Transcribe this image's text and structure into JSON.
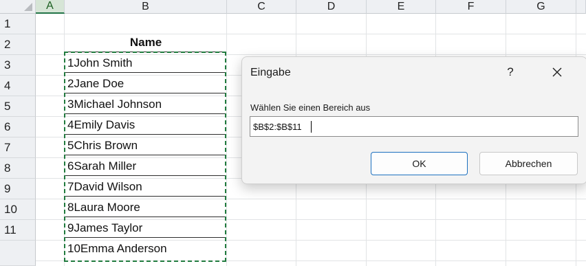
{
  "columns": [
    "A",
    "B",
    "C",
    "D",
    "E",
    "F",
    "G"
  ],
  "rows": [
    "1",
    "2",
    "3",
    "4",
    "5",
    "6",
    "7",
    "8",
    "9",
    "10",
    "11"
  ],
  "column_b": {
    "header": "Name",
    "values": [
      "1John Smith",
      "2Jane Doe",
      "3Michael Johnson",
      "4Emily Davis",
      "5Chris Brown",
      "6Sarah Miller",
      "7David Wilson",
      "8Laura Moore",
      "9James Taylor",
      "10Emma Anderson"
    ]
  },
  "dialog": {
    "title": "Eingabe",
    "help": "?",
    "prompt": "Wählen Sie einen Bereich aus",
    "input_value": "$B$2:$B$11",
    "ok_label": "OK",
    "cancel_label": "Abbrechen"
  },
  "colors": {
    "selection_marquee": "#1f7a3d",
    "header_bg": "#eef0f3",
    "selected_column_header": "#d6e5d6",
    "ok_button_border": "#1b6fbf"
  },
  "icons": {
    "close": "close-icon",
    "select_all": "select-all-corner-icon"
  }
}
